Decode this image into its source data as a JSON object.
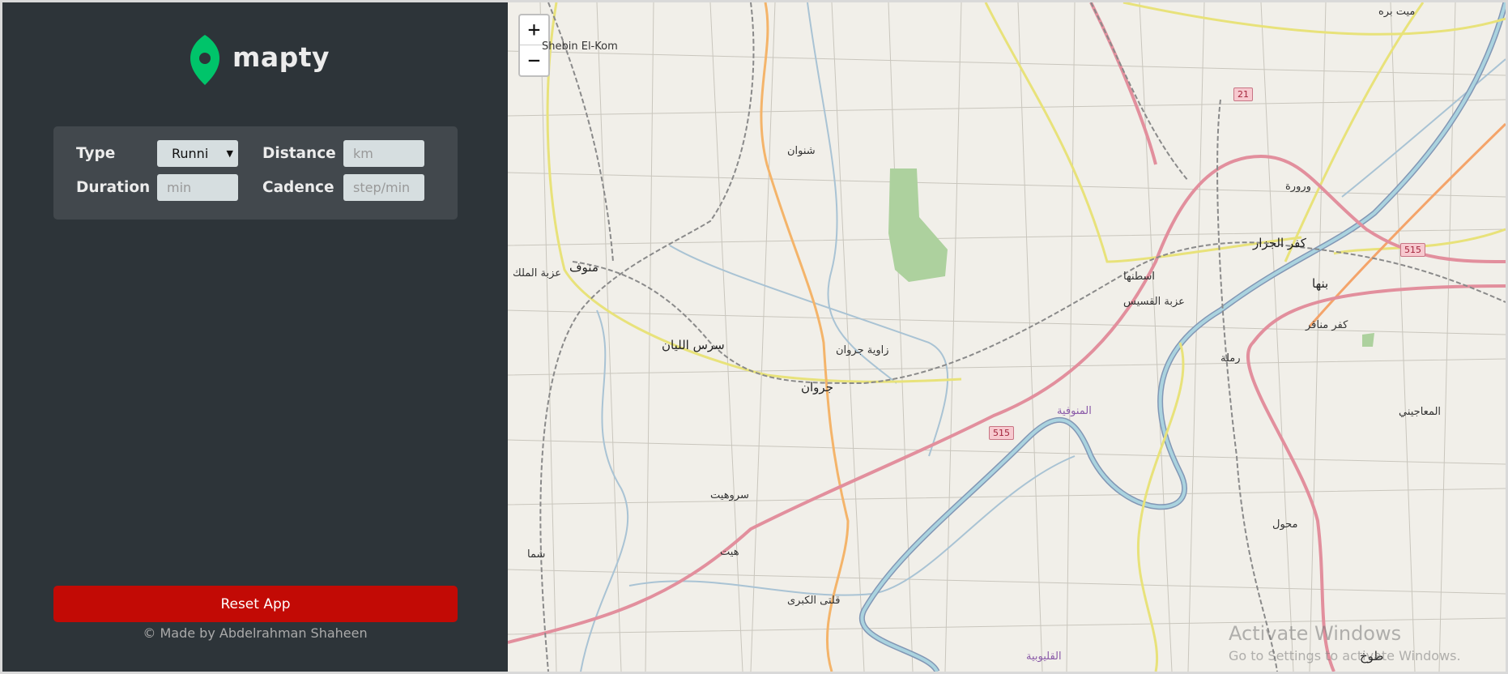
{
  "app": {
    "brand": "mapty"
  },
  "form": {
    "type_label": "Type",
    "type_value": "Runni",
    "distance_label": "Distance",
    "distance_placeholder": "km",
    "duration_label": "Duration",
    "duration_placeholder": "min",
    "cadence_label": "Cadence",
    "cadence_placeholder": "step/min"
  },
  "actions": {
    "reset_label": "Reset App"
  },
  "footer": {
    "copyright": "© Made by Abdelrahman Shaheen"
  },
  "map": {
    "zoom_in": "+",
    "zoom_out": "−",
    "places": [
      "Shebin El-Kom",
      "منوف",
      "عزبة الملك",
      "سرس الليان",
      "شنوان",
      "زاوية جروان",
      "جروان",
      "سروهيت",
      "هيت",
      "شما",
      "قلتى الكبرى",
      "اسطنها",
      "عزبة القسيس",
      "كفر الجزار",
      "بنها",
      "كفر مناقر",
      "رملة",
      "المعاجيني",
      "محول",
      "طوخ",
      "ميت بره",
      "ورورة",
      "المنوفية",
      "القليوبية"
    ],
    "road_shields": [
      "21",
      "515",
      "515"
    ],
    "watermark_line1": "Activate Windows",
    "watermark_line2": "Go to Settings to activate Windows."
  },
  "colors": {
    "sidebar": "#2d3439",
    "reset": "#c20a05",
    "brand_green": "#00c46a"
  }
}
